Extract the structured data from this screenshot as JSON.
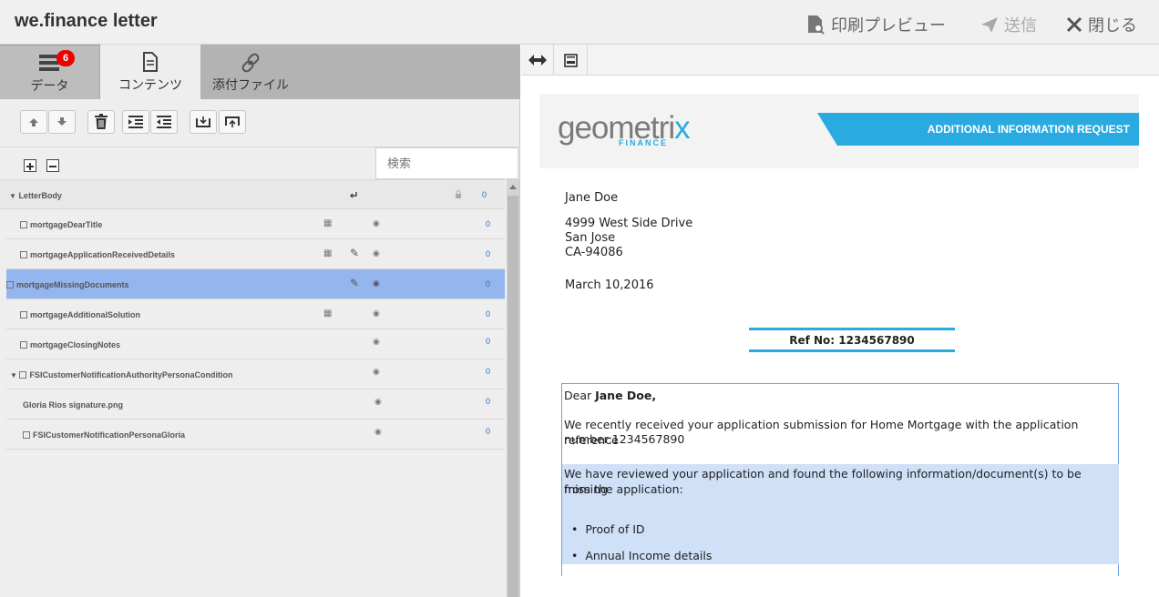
{
  "header": {
    "title": "we.finance letter",
    "print_preview": "印刷プレビュー",
    "send": "送信",
    "close": "閉じる"
  },
  "tabs": {
    "data": "データ",
    "data_badge": "6",
    "content": "コンテンツ",
    "attachments": "添付ファイル"
  },
  "search": {
    "placeholder": "検索"
  },
  "tree": {
    "root": {
      "label": "LetterBody",
      "count": "0"
    },
    "rows": [
      {
        "label": "mortgageDearTitle",
        "count": "0"
      },
      {
        "label": "mortgageApplicationReceivedDetails",
        "count": "0"
      },
      {
        "label": "mortgageMissingDocuments",
        "count": "0"
      },
      {
        "label": "mortgageAdditionalSolution",
        "count": "0"
      },
      {
        "label": "mortgageClosingNotes",
        "count": "0"
      },
      {
        "label": "FSICustomerNotificationAuthorityPersonaCondition",
        "count": "0"
      },
      {
        "label": "Gloria Rios signature.png",
        "count": "0"
      },
      {
        "label": "FSICustomerNotificationPersonaGloria",
        "count": "0"
      }
    ]
  },
  "letter": {
    "logo_main": "geometri",
    "logo_x": "x",
    "logo_sub": "FINANCE",
    "banner": "ADDITIONAL INFORMATION REQUEST",
    "name": "Jane Doe",
    "address1": "4999 West Side Drive",
    "address2": "San Jose",
    "address3": "CA-94086",
    "date": "March 10,2016",
    "ref": "Ref No: 1234567890",
    "dear": "Dear ",
    "dear_name": "Jane Doe,",
    "para1_line1": "We recently received your application submission for Home Mortgage with the application reference",
    "para1_line2": "number:1234567890",
    "para2_line1": "We have reviewed your application and found the following information/document(s) to be missing",
    "para2_line2": "from the application:",
    "bullet1": "Proof of ID",
    "bullet2": "Annual Income details"
  },
  "colors": {
    "accent": "#29aae1",
    "selected_row": "#94b5ee",
    "badge": "#ee0000"
  }
}
